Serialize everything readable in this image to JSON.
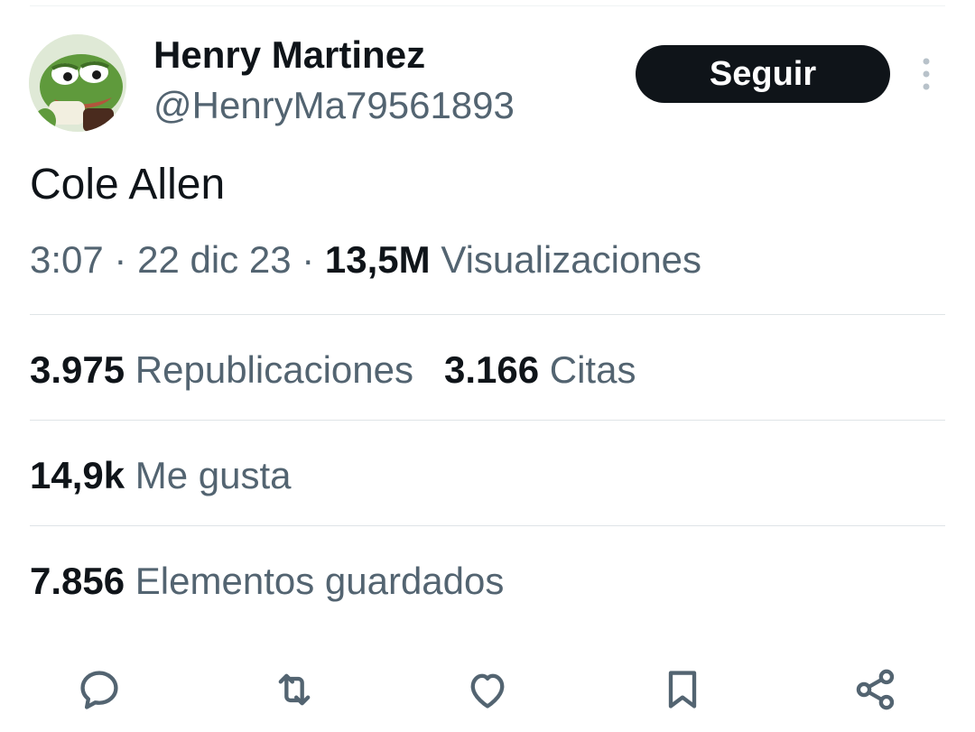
{
  "author": {
    "name": "Henry Martinez",
    "handle": "@HenryMa79561893",
    "avatar_icon": "frog-avatar-icon"
  },
  "follow_label": "Seguir",
  "tweet": {
    "text": "Cole Allen",
    "time": "3:07",
    "separator": "·",
    "date": "22 dic 23",
    "views_count": "13,5M",
    "views_label": "Visualizaciones"
  },
  "stats": {
    "reposts_count": "3.975",
    "reposts_label": "Republicaciones",
    "quotes_count": "3.166",
    "quotes_label": "Citas",
    "likes_count": "14,9k",
    "likes_label": "Me gusta",
    "bookmarks_count": "7.856",
    "bookmarks_label": "Elementos guardados"
  },
  "actions": [
    "reply-icon",
    "repost-icon",
    "like-icon",
    "bookmark-icon",
    "share-icon"
  ],
  "colors": {
    "text_primary": "#0f1419",
    "text_secondary": "#536471",
    "divider": "#dfe4e7",
    "button_bg": "#0f1419",
    "button_text": "#ffffff"
  }
}
